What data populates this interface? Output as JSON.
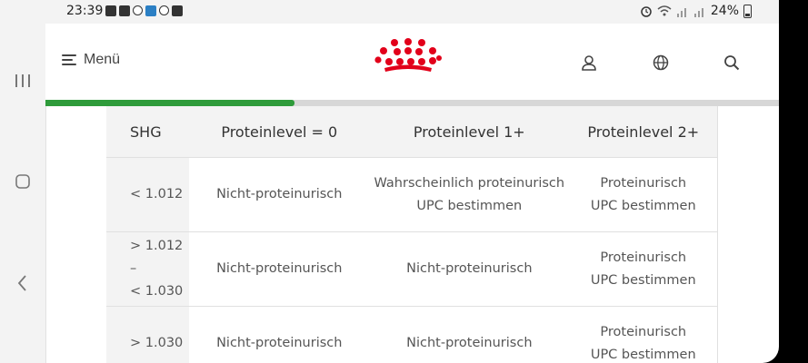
{
  "status_bar": {
    "time": "23:39",
    "battery": "24%"
  },
  "header": {
    "menu_label": "Menü"
  },
  "progress": {
    "value_percent": 34,
    "color": "#2e9b3a"
  },
  "brand": {
    "logo_color": "#e2001a"
  },
  "table": {
    "headers": [
      "SHG",
      "Proteinlevel = 0",
      "Proteinlevel 1+",
      "Proteinlevel 2+"
    ],
    "rows": [
      {
        "shg": [
          "< 1.012"
        ],
        "p0": [
          "Nicht-proteinurisch"
        ],
        "p1": [
          "Wahrscheinlich proteinurisch",
          "UPC bestimmen"
        ],
        "p2": [
          "Proteinurisch",
          "UPC bestimmen"
        ]
      },
      {
        "shg": [
          "> 1.012 –",
          "< 1.030"
        ],
        "p0": [
          "Nicht-proteinurisch"
        ],
        "p1": [
          "Nicht-proteinurisch"
        ],
        "p2": [
          "Proteinurisch",
          "UPC bestimmen"
        ]
      },
      {
        "shg": [
          "> 1.030"
        ],
        "p0": [
          "Nicht-proteinurisch"
        ],
        "p1": [
          "Nicht-proteinurisch"
        ],
        "p2": [
          "Proteinurisch",
          "UPC bestimmen"
        ]
      }
    ]
  }
}
